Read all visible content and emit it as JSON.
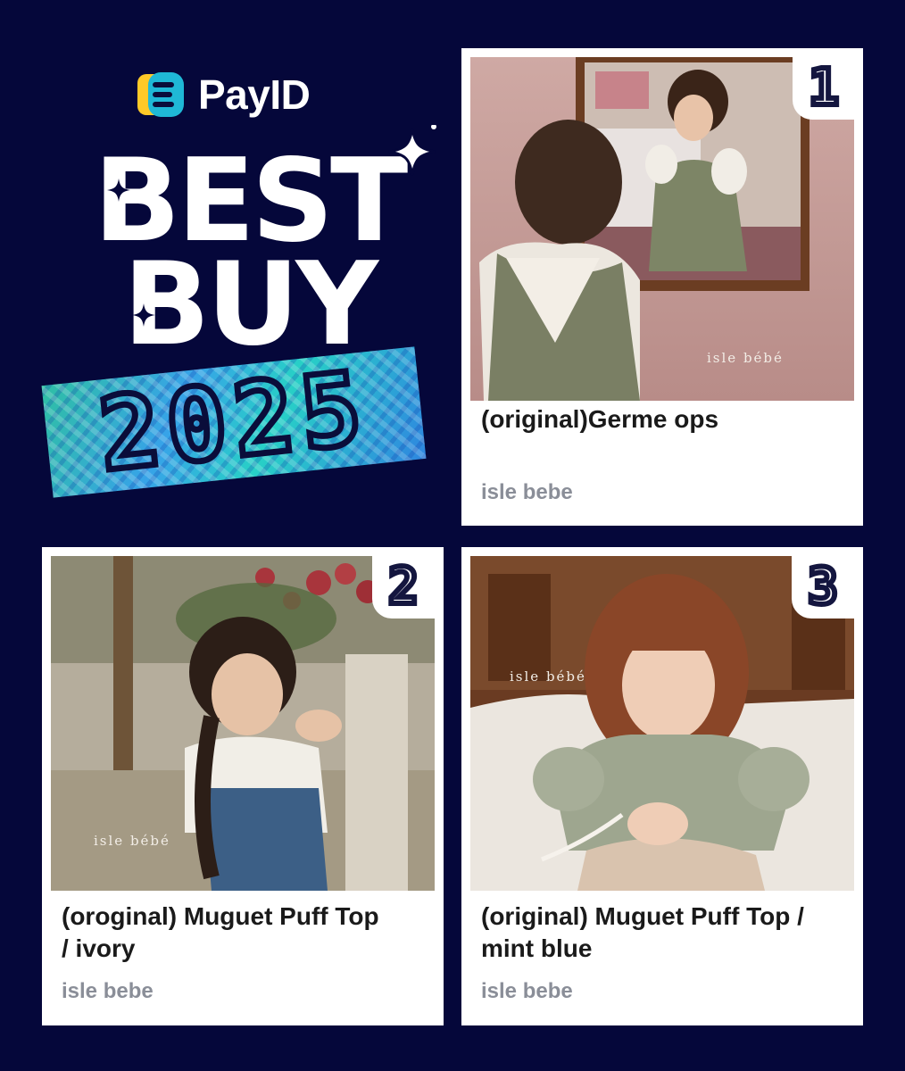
{
  "brand": {
    "name": "PayID",
    "logo_icon": "payid-logo-icon"
  },
  "headline": {
    "line1": "BEST",
    "line2": "BUY",
    "year": "2025"
  },
  "products": [
    {
      "rank": "1",
      "title": "(original)Germe ops",
      "shop": "isle bebe",
      "image_watermark": "isle bébé"
    },
    {
      "rank": "2",
      "title": "(oroginal) Muguet Puff Top / ivory",
      "shop": "isle bebe",
      "image_watermark": "isle bébé"
    },
    {
      "rank": "3",
      "title": "(original) Muguet Puff Top / mint blue",
      "shop": "isle bebe",
      "image_watermark": "isle bébé"
    }
  ],
  "colors": {
    "background": "#05073a",
    "card": "#ffffff",
    "badge_holo": "#37a3e8",
    "muted_text": "#8a8e98"
  }
}
